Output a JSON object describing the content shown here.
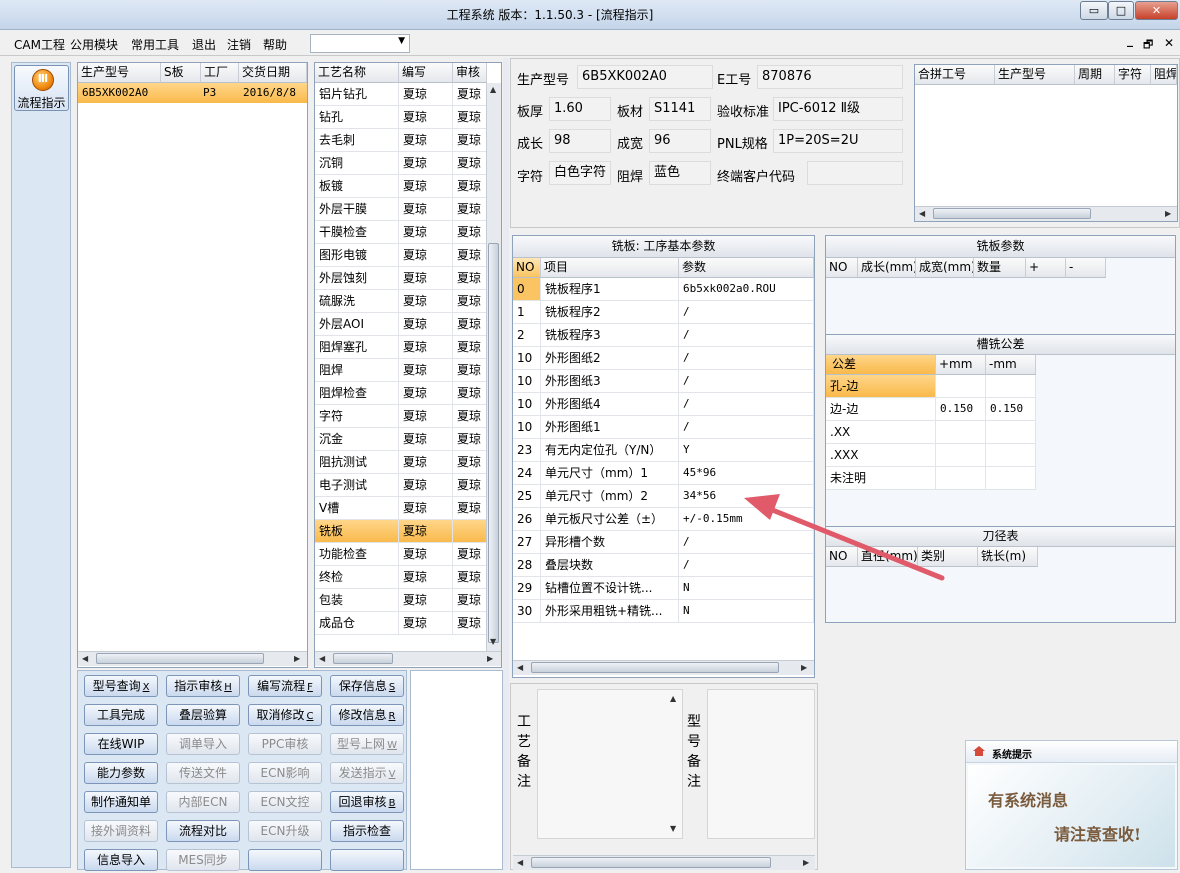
{
  "window": {
    "title": "工程系统  版本：1.1.50.3 - [流程指示]",
    "min": "▭",
    "max": "□",
    "close": "✕"
  },
  "menu": {
    "items": [
      "CAM工程",
      "公用模块",
      "常用工具",
      "退出",
      "注销",
      "帮助"
    ],
    "mdi": [
      "_",
      "🗗",
      "✕"
    ]
  },
  "sidebar": {
    "nav_label": "流程指示",
    "nav_icon_glyph": "Ⅲ"
  },
  "orders": {
    "headers": [
      "生产型号",
      "S板",
      "工厂",
      "交货日期"
    ],
    "rows": [
      [
        "6B5XK002A0",
        "",
        "P3",
        "2016/8/8"
      ]
    ]
  },
  "process": {
    "headers": [
      "工艺名称",
      "编写",
      "审核"
    ],
    "rows": [
      [
        "铝片钻孔",
        "夏琼",
        "夏琼"
      ],
      [
        "钻孔",
        "夏琼",
        "夏琼"
      ],
      [
        "去毛刺",
        "夏琼",
        "夏琼"
      ],
      [
        "沉铜",
        "夏琼",
        "夏琼"
      ],
      [
        "板镀",
        "夏琼",
        "夏琼"
      ],
      [
        "外层干膜",
        "夏琼",
        "夏琼"
      ],
      [
        "干膜检查",
        "夏琼",
        "夏琼"
      ],
      [
        "图形电镀",
        "夏琼",
        "夏琼"
      ],
      [
        "外层蚀刻",
        "夏琼",
        "夏琼"
      ],
      [
        "硫脲洗",
        "夏琼",
        "夏琼"
      ],
      [
        "外层AOI",
        "夏琼",
        "夏琼"
      ],
      [
        "阻焊塞孔",
        "夏琼",
        "夏琼"
      ],
      [
        "阻焊",
        "夏琼",
        "夏琼"
      ],
      [
        "阻焊检查",
        "夏琼",
        "夏琼"
      ],
      [
        "字符",
        "夏琼",
        "夏琼"
      ],
      [
        "沉金",
        "夏琼",
        "夏琼"
      ],
      [
        "阻抗测试",
        "夏琼",
        "夏琼"
      ],
      [
        "电子测试",
        "夏琼",
        "夏琼"
      ],
      [
        "V槽",
        "夏琼",
        "夏琼"
      ],
      [
        "铣板",
        "夏琼",
        ""
      ],
      [
        "功能检查",
        "夏琼",
        "夏琼"
      ],
      [
        "终检",
        "夏琼",
        "夏琼"
      ],
      [
        "包装",
        "夏琼",
        "夏琼"
      ],
      [
        "成品仓",
        "夏琼",
        "夏琼"
      ]
    ],
    "selected_index": 19
  },
  "buttons": [
    {
      "label": "型号查询",
      "key": "X",
      "enabled": true
    },
    {
      "label": "指示审核",
      "key": "H",
      "enabled": true
    },
    {
      "label": "编写流程",
      "key": "F",
      "enabled": true
    },
    {
      "label": "保存信息",
      "key": "S",
      "enabled": true
    },
    {
      "label": "工具完成",
      "key": "",
      "enabled": true
    },
    {
      "label": "叠层验算",
      "key": "",
      "enabled": true
    },
    {
      "label": "取消修改",
      "key": "C",
      "enabled": true
    },
    {
      "label": "修改信息",
      "key": "R",
      "enabled": true
    },
    {
      "label": "在线WIP",
      "key": "",
      "enabled": true
    },
    {
      "label": "调单导入",
      "key": "",
      "enabled": false
    },
    {
      "label": "PPC审核",
      "key": "",
      "enabled": false
    },
    {
      "label": "型号上网",
      "key": "W",
      "enabled": false
    },
    {
      "label": "能力参数",
      "key": "",
      "enabled": true
    },
    {
      "label": "传送文件",
      "key": "",
      "enabled": false
    },
    {
      "label": "ECN影响",
      "key": "",
      "enabled": false
    },
    {
      "label": "发送指示",
      "key": "V",
      "enabled": false
    },
    {
      "label": "制作通知单",
      "key": "",
      "enabled": true
    },
    {
      "label": "内部ECN",
      "key": "",
      "enabled": false
    },
    {
      "label": "ECN文控",
      "key": "",
      "enabled": false
    },
    {
      "label": "回退审核",
      "key": "B",
      "enabled": true
    },
    {
      "label": "接外调资料",
      "key": "",
      "enabled": false
    },
    {
      "label": "流程对比",
      "key": "",
      "enabled": true
    },
    {
      "label": "ECN升级",
      "key": "",
      "enabled": false
    },
    {
      "label": "指示检查",
      "key": "",
      "enabled": true
    },
    {
      "label": "信息导入",
      "key": "",
      "enabled": true
    },
    {
      "label": "MES同步",
      "key": "",
      "enabled": false
    },
    {
      "label": "",
      "key": "",
      "enabled": true
    },
    {
      "label": "",
      "key": "",
      "enabled": true
    }
  ],
  "info": {
    "production_model_label": "生产型号",
    "production_model": "6B5XK002A0",
    "e_no_label": "E工号",
    "e_no": "870876",
    "thickness_label": "板厚",
    "thickness": "1.60",
    "material_label": "板材",
    "material": "S1141",
    "standard_label": "验收标准",
    "standard": "IPC-6012 Ⅱ级",
    "length_label": "成长",
    "length": "98",
    "width_label": "成宽",
    "width": "96",
    "pnl_label": "PNL规格",
    "pnl": "1P=20S=2U",
    "silk_label": "字符",
    "silk": "白色字符",
    "mask_label": "阻焊",
    "mask": "蓝色",
    "customer_label": "终端客户代码",
    "customer": ""
  },
  "combine": {
    "headers": [
      "合拼工号",
      "生产型号",
      "周期",
      "字符",
      "阻焊"
    ]
  },
  "params": {
    "title": "铣板: 工序基本参数",
    "headers": [
      "NO",
      "项目",
      "参数"
    ],
    "rows": [
      [
        "0",
        "铣板程序1",
        "6b5xk002a0.ROU"
      ],
      [
        "1",
        "铣板程序2",
        "/"
      ],
      [
        "2",
        "铣板程序3",
        "/"
      ],
      [
        "10",
        "外形图纸2",
        "/"
      ],
      [
        "10",
        "外形图纸3",
        "/"
      ],
      [
        "10",
        "外形图纸4",
        "/"
      ],
      [
        "10",
        "外形图纸1",
        "/"
      ],
      [
        "23",
        "有无内定位孔（Y/N）",
        "Y"
      ],
      [
        "24",
        "单元尺寸（mm）1",
        "45*96"
      ],
      [
        "25",
        "单元尺寸（mm）2",
        "34*56"
      ],
      [
        "26",
        "单元板尺寸公差（±）",
        "+/-0.15mm"
      ],
      [
        "27",
        "异形槽个数",
        "/"
      ],
      [
        "28",
        "叠层块数",
        "/"
      ],
      [
        "29",
        "钻槽位置不设计铣...",
        "N"
      ],
      [
        "30",
        "外形采用粗铣+精铣...",
        "N"
      ]
    ]
  },
  "mill": {
    "title": "铣板参数",
    "headers": [
      "NO",
      "成长(mm)",
      "成宽(mm)",
      "数量",
      "+",
      "-"
    ]
  },
  "tol": {
    "title": "槽铣公差",
    "headers": [
      "公差",
      "+mm",
      "-mm"
    ],
    "rows": [
      [
        "孔-边",
        "",
        ""
      ],
      [
        "边-边",
        "0.150",
        "0.150"
      ],
      [
        ".XX",
        "",
        ""
      ],
      [
        ".XXX",
        "",
        ""
      ],
      [
        "未注明",
        "",
        ""
      ]
    ]
  },
  "tool": {
    "title": "刀径表",
    "headers": [
      "NO",
      "直径(mm)",
      "类别",
      "铣长(m)"
    ]
  },
  "remarks": {
    "process_label": "工艺备注",
    "model_label": "型号备注"
  },
  "notify": {
    "title": "系统提示",
    "line1": "有系统消息",
    "line2": "请注意查收!"
  },
  "colors": {
    "selection": "#f9b94a",
    "accent_arrow": "#e05a6a"
  }
}
